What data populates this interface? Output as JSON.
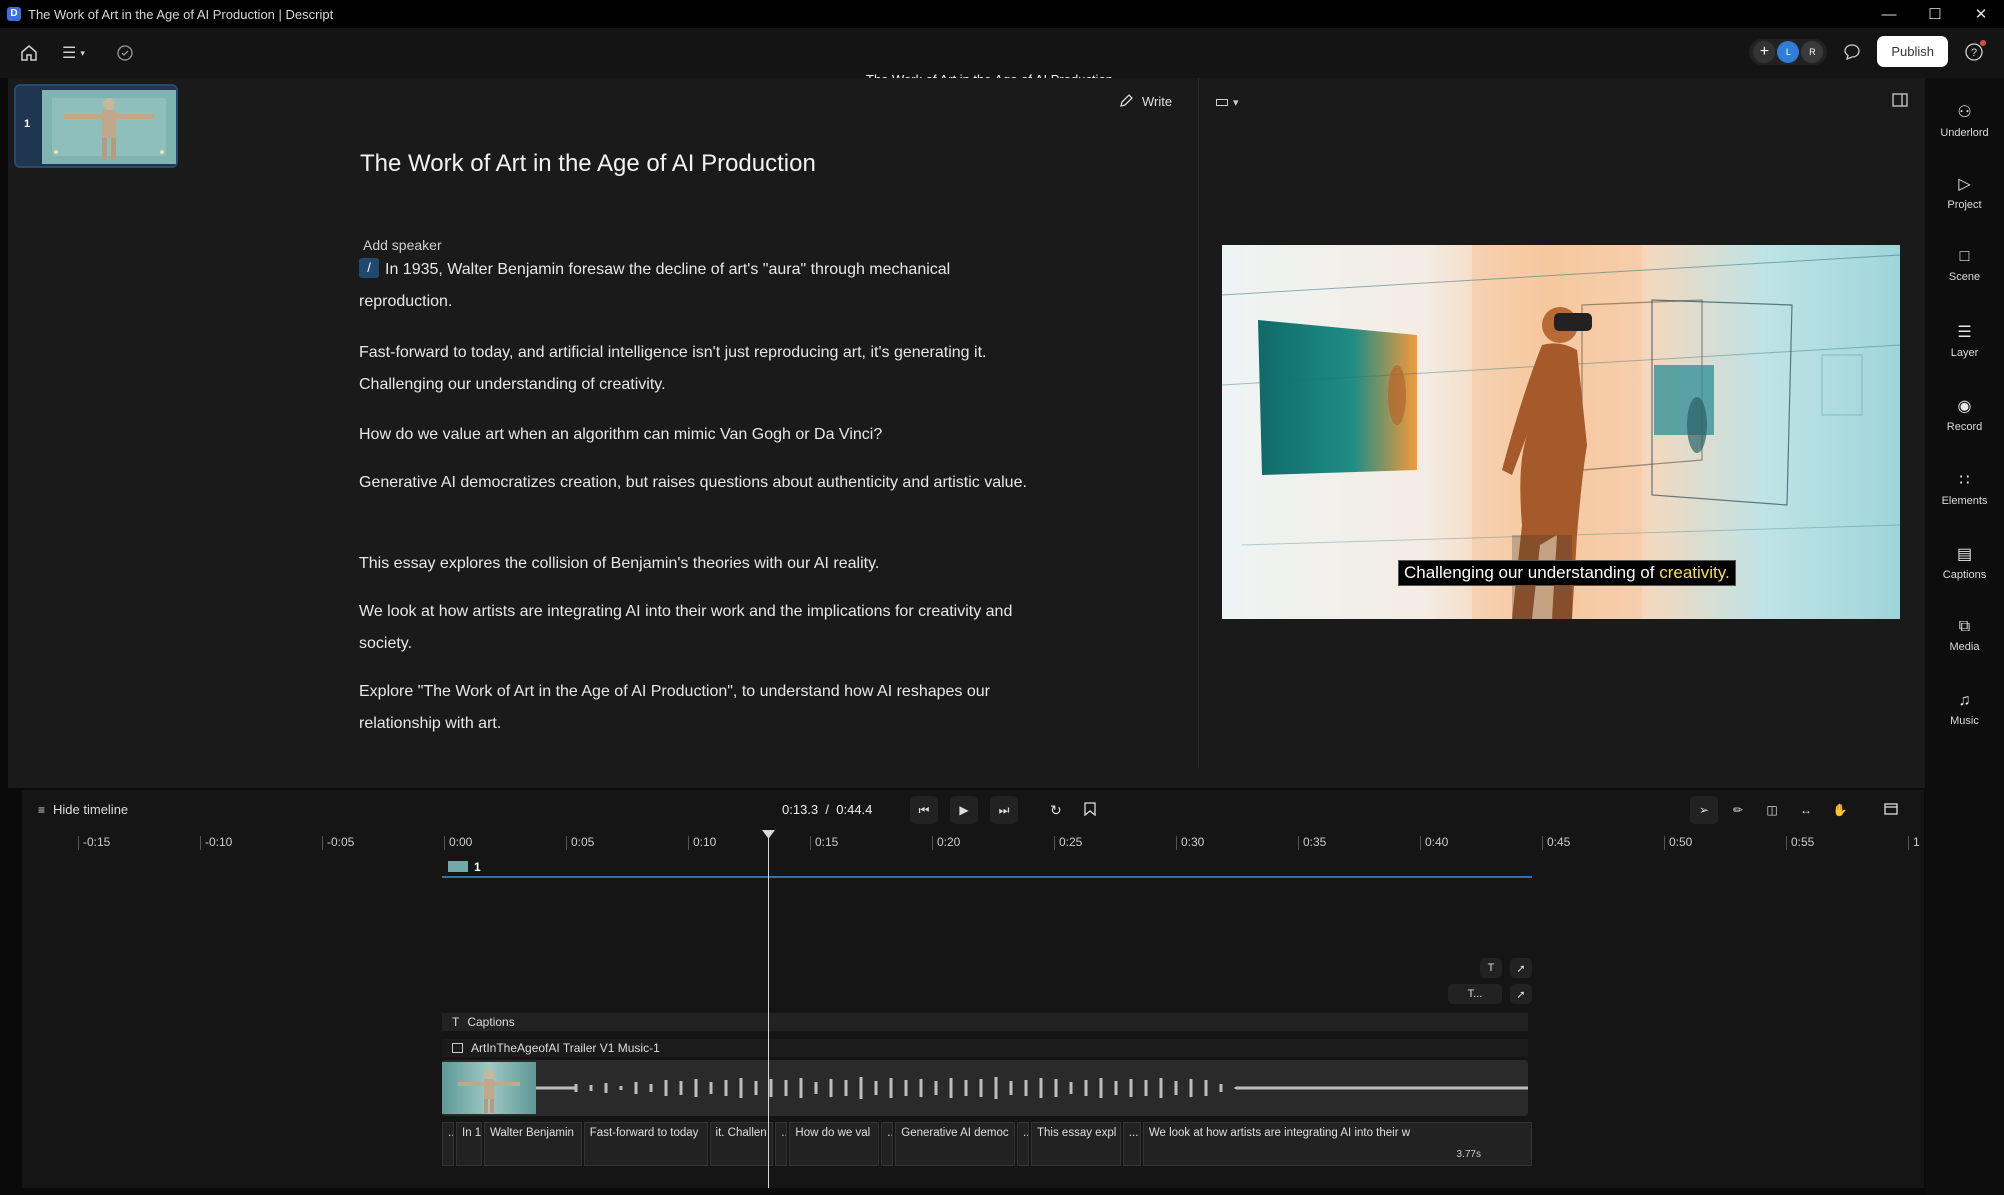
{
  "window": {
    "title": "The Work of Art in the Age of AI Production | Descript",
    "app_icon": "D"
  },
  "toolbar": {
    "doc_title": "The Work of Art in the Age of AI Production",
    "avatar_initials": [
      "L",
      "R"
    ],
    "publish_label": "Publish"
  },
  "scenes": [
    {
      "number": "1"
    }
  ],
  "editor": {
    "write_label": "Write",
    "title": "The Work of Art in the Age of AI Production",
    "speaker_placeholder": "Add speaker",
    "slash": "/",
    "paragraphs": [
      "In 1935, Walter Benjamin foresaw the decline of art's \"aura\" through mechanical reproduction.",
      "Fast-forward to today, and artificial intelligence isn't just reproducing art, it's generating it. Challenging our understanding of creativity.",
      "How do we value art when an algorithm can mimic Van Gogh or Da Vinci?",
      "Generative AI democratizes creation, but raises questions about authenticity and artistic value.",
      "This essay explores the collision of Benjamin's theories with our AI reality.",
      "We look at how artists are integrating AI into their work and the implications for creativity and society.",
      "Explore \"The Work of Art in the Age of AI Production\", to understand how AI reshapes our relationship with art."
    ]
  },
  "preview": {
    "caption_prefix": "Challenging our understanding of",
    "caption_highlight": "creativity."
  },
  "sidebar": {
    "items": [
      {
        "label": "Underlord",
        "icon": "robot-icon"
      },
      {
        "label": "Project",
        "icon": "project-icon"
      },
      {
        "label": "Scene",
        "icon": "scene-icon"
      },
      {
        "label": "Layer",
        "icon": "layers-icon"
      },
      {
        "label": "Record",
        "icon": "record-icon"
      },
      {
        "label": "Elements",
        "icon": "elements-icon"
      },
      {
        "label": "Captions",
        "icon": "captions-icon"
      },
      {
        "label": "Media",
        "icon": "media-icon"
      },
      {
        "label": "Music",
        "icon": "music-icon"
      }
    ]
  },
  "timeline": {
    "hide_label": "Hide timeline",
    "current_time": "0:13.3",
    "separator": "/",
    "total_time": "0:44.4",
    "ruler": [
      "-0:15",
      "-0:10",
      "-0:05",
      "0:00",
      "0:05",
      "0:10",
      "0:15",
      "0:20",
      "0:25",
      "0:30",
      "0:35",
      "0:40",
      "0:45",
      "0:50",
      "0:55",
      "1"
    ],
    "scene_label": "1",
    "captions_track": "Captions",
    "text_tool": "T",
    "text_tool_2": "T...",
    "music_track": "ArtInTheAgeofAI Trailer V1 Music-1",
    "words": [
      "..",
      "In 1!",
      "Walter Benjamin",
      "Fast-forward to today",
      "it. Challen",
      "..",
      "How do we val",
      "..",
      "Generative AI democ",
      "..",
      "This essay expl",
      "...",
      "We look at how artists are integrating AI into their w"
    ],
    "end_duration": "3.77s"
  },
  "colors": {
    "accent_blue": "#2e6fb0",
    "caption_highlight": "#f4e04d",
    "panel_bg": "#1a1a1a"
  }
}
